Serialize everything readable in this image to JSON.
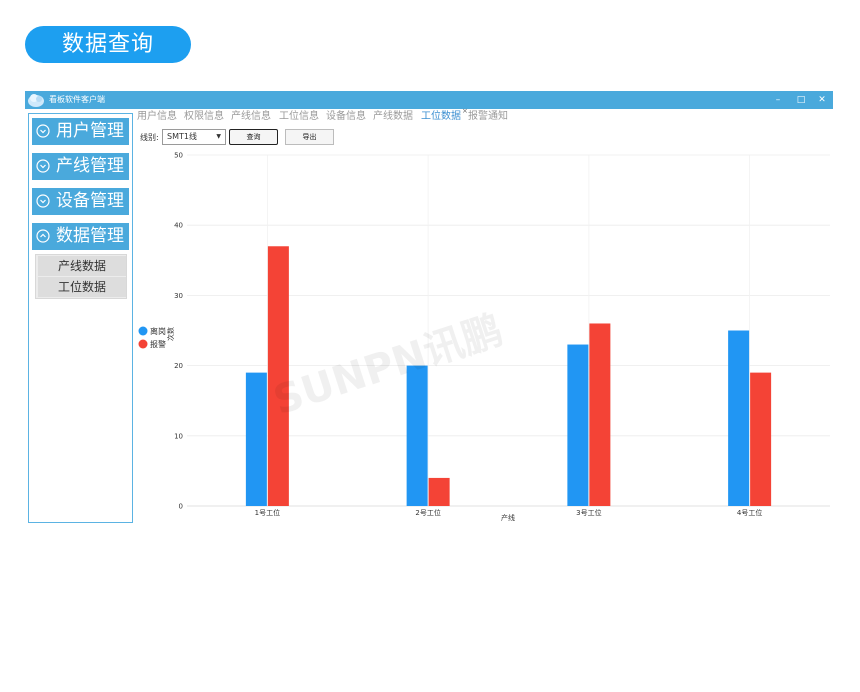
{
  "page_title": "数据查询",
  "window": {
    "title": "看板软件客户端",
    "buttons": {
      "minimize": "–",
      "maximize": "□",
      "close": "✕"
    }
  },
  "sidebar": {
    "groups": [
      {
        "label": "用户管理",
        "icon": "chevron-down-icon"
      },
      {
        "label": "产线管理",
        "icon": "chevron-down-icon"
      },
      {
        "label": "设备管理",
        "icon": "chevron-down-icon"
      },
      {
        "label": "数据管理",
        "icon": "chevron-up-icon"
      }
    ],
    "subitems": [
      "产线数据",
      "工位数据"
    ]
  },
  "tabs": [
    {
      "label": "用户信息",
      "active": false
    },
    {
      "label": "权限信息",
      "active": false
    },
    {
      "label": "产线信息",
      "active": false
    },
    {
      "label": "工位信息",
      "active": false
    },
    {
      "label": "设备信息",
      "active": false
    },
    {
      "label": "产线数据",
      "active": false
    },
    {
      "label": "工位数据",
      "active": true
    },
    {
      "label": "报警通知",
      "active": false
    }
  ],
  "tab_close": "×",
  "filter": {
    "label": "线别:",
    "selected": "SMT1线",
    "query_button": "查询",
    "export_button": "导出"
  },
  "watermark": "SUNPN讯鹏",
  "colors": {
    "series1": "#2196f3",
    "series2": "#f44336",
    "accent": "#1d9ff0",
    "titlebar": "#4aa9dc"
  },
  "chart_data": {
    "type": "bar",
    "categories": [
      "1号工位",
      "2号工位",
      "3号工位",
      "4号工位"
    ],
    "series": [
      {
        "name": "离岗",
        "values": [
          19,
          20,
          23,
          25
        ]
      },
      {
        "name": "报警",
        "values": [
          37,
          4,
          26,
          19
        ]
      }
    ],
    "xlabel": "产线",
    "ylabel": "次数",
    "ylim": [
      0,
      50
    ],
    "yticks": [
      0,
      10,
      20,
      30,
      40,
      50
    ],
    "grid": true,
    "legend_position": "left"
  }
}
